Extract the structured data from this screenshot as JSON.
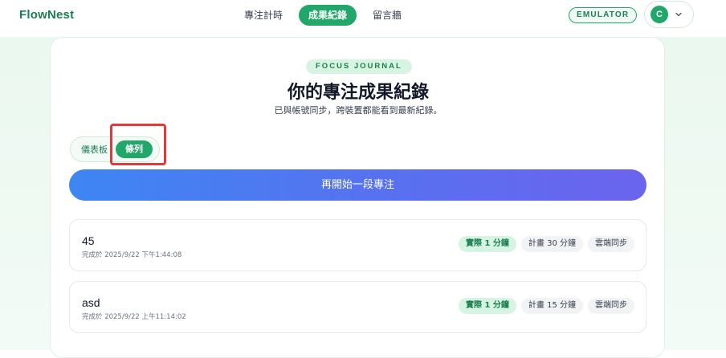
{
  "app": {
    "name": "FlowNest"
  },
  "nav": {
    "items": [
      {
        "label": "專注計時"
      },
      {
        "label": "成果紀錄"
      },
      {
        "label": "留言牆"
      }
    ]
  },
  "header": {
    "emulator_badge": "EMULATOR",
    "user_initial": "C"
  },
  "journal": {
    "eyebrow": "FOCUS JOURNAL",
    "title": "你的專注成果紀錄",
    "subtitle": "已與帳號同步，跨裝置都能看到最新紀錄。",
    "view_toggle": {
      "dashboard": "儀表板",
      "list": "條列"
    },
    "start_button": "再開始一段專注",
    "sessions": [
      {
        "name": "45",
        "completed": "完成於 2025/9/22 下午1:44:08",
        "actual": "實際 1 分鐘",
        "planned": "計畫 30 分鐘",
        "sync": "雲端同步"
      },
      {
        "name": "asd",
        "completed": "完成於 2025/9/22 上午11:14:02",
        "actual": "實際 1 分鐘",
        "planned": "計畫 15 分鐘",
        "sync": "雲端同步"
      }
    ]
  },
  "colors": {
    "brand": "#21a76a",
    "highlight": "#e03a3a",
    "gradient_start": "#3d86f2",
    "gradient_end": "#6b64ee"
  }
}
